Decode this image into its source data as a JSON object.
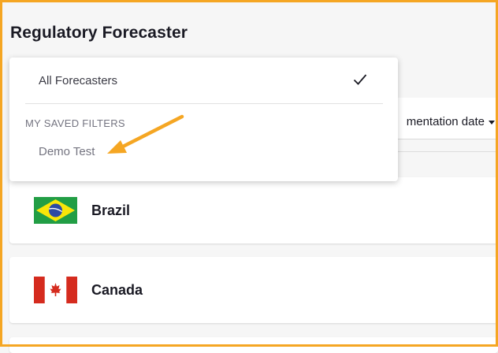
{
  "app": {
    "title": "Regulatory Forecaster"
  },
  "sort": {
    "label": "mentation date"
  },
  "dropdown": {
    "all_label": "All Forecasters",
    "section_label": "MY SAVED FILTERS",
    "saved_filters": [
      {
        "label": "Demo Test"
      }
    ]
  },
  "countries": [
    {
      "name": "Brazil",
      "flag": "brazil-flag-icon"
    },
    {
      "name": "Canada",
      "flag": "canada-flag-icon"
    }
  ],
  "colors": {
    "annotation_arrow": "#f5a623",
    "frame_border": "#f5a623",
    "background": "#f6f6f6",
    "text_primary": "#1a1a24",
    "text_muted": "#747480"
  }
}
